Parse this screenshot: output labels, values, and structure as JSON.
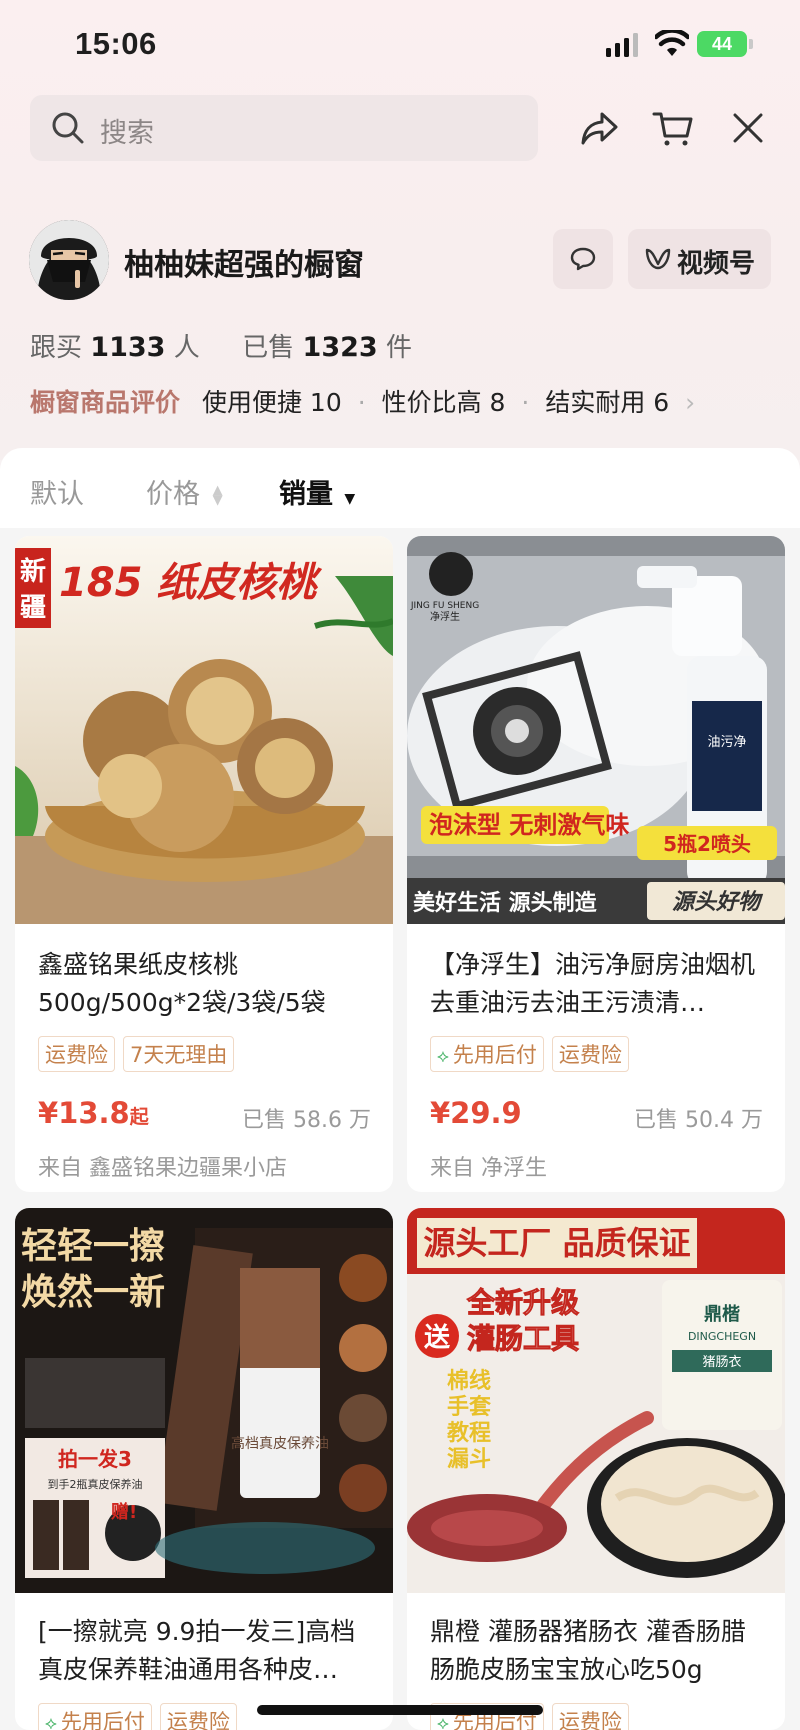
{
  "status_bar": {
    "time": "15:06",
    "battery": "44"
  },
  "search": {
    "placeholder": "搜索"
  },
  "shop": {
    "name": "柚柚妹超强的橱窗",
    "video_button": "视频号",
    "stats": {
      "follow_label": "跟买",
      "follow_count": "1133",
      "follow_unit": "人",
      "sold_label": "已售",
      "sold_count": "1323",
      "sold_unit": "件"
    },
    "reviews": {
      "title": "橱窗商品评价",
      "items": [
        "使用便捷 10",
        "性价比高 8",
        "结实耐用 6"
      ]
    }
  },
  "sort": {
    "default": "默认",
    "price": "价格",
    "sales": "销量"
  },
  "products": [
    {
      "image_text": [
        "新",
        "疆",
        "185 纸皮核桃"
      ],
      "title": "鑫盛铭果纸皮核桃500g/500g*2袋/3袋/5袋",
      "tags": [
        "运费险",
        "7天无理由"
      ],
      "price": "¥13.8",
      "price_suffix": "起",
      "sold": "已售 58.6 万",
      "from": "来自 鑫盛铭果边疆果小店"
    },
    {
      "image_text": [
        "JING FU SHENG",
        "净浮生",
        "泡沫型 无刺激气味",
        "5瓶2喷头",
        "美好生活 源头制造",
        "源头好物",
        "油污净"
      ],
      "title": "【净浮生】油污净厨房油烟机去重油污去油王污渍清…",
      "tags": [
        "先用后付",
        "运费险"
      ],
      "price": "¥29.9",
      "price_suffix": "",
      "sold": "已售 50.4 万",
      "from": "来自 净浮生"
    },
    {
      "image_text": [
        "轻轻一擦",
        "焕然一新",
        "拍一发3",
        "到手2瓶真皮保养油",
        "赠!",
        "高档真皮保养油"
      ],
      "title": "[一擦就亮 9.9拍一发三]高档真皮保养鞋油通用各种皮…",
      "tags": [
        "先用后付",
        "运费险"
      ]
    },
    {
      "image_text": [
        "源头工厂 品质保证",
        "送",
        "全新升级",
        "灌肠工具",
        "棉线",
        "手套",
        "教程",
        "漏斗",
        "鼎楷",
        "DINGCHEGN",
        "猪肠衣"
      ],
      "title": "鼎橙 灌肠器猪肠衣 灌香肠腊肠脆皮肠宝宝放心吃50g",
      "tags": [
        "先用后付",
        "运费险"
      ]
    }
  ]
}
